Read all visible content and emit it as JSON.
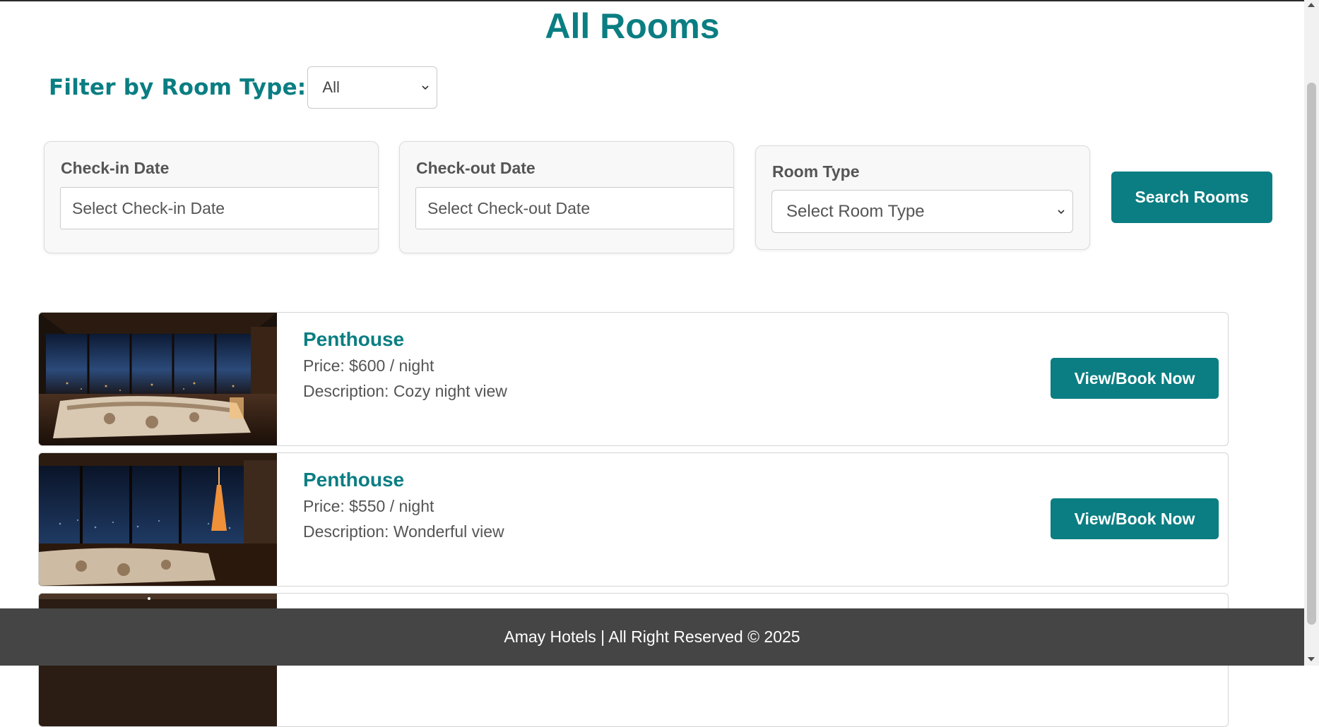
{
  "page": {
    "title": "All Rooms"
  },
  "filter": {
    "label": "Filter by Room Type:",
    "selected": "All"
  },
  "search": {
    "checkin_label": "Check-in Date",
    "checkin_placeholder": "Select Check-in Date",
    "checkout_label": "Check-out Date",
    "checkout_placeholder": "Select Check-out Date",
    "roomtype_label": "Room Type",
    "roomtype_selected": "Select Room Type",
    "button_label": "Search Rooms"
  },
  "rooms": [
    {
      "name": "Penthouse",
      "price": "Price: $600 / night",
      "description": "Description: Cozy night view",
      "button": "View/Book Now"
    },
    {
      "name": "Penthouse",
      "price": "Price: $550 / night",
      "description": "Description: Wonderful view",
      "button": "View/Book Now"
    }
  ],
  "footer": {
    "text": "Amay Hotels | All Right Reserved © 2025"
  },
  "colors": {
    "accent": "#0a7e82",
    "footer_bg": "#454545"
  }
}
